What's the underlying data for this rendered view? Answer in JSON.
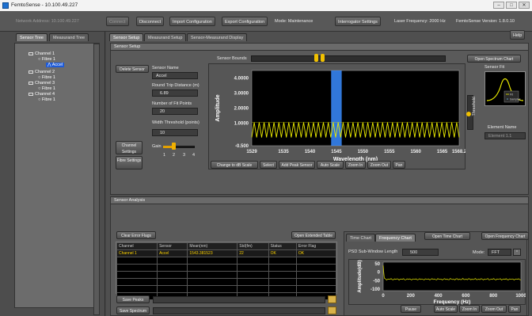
{
  "window": {
    "title": "FemtoSense - 10.100.49.227"
  },
  "toolbar": {
    "network_address": "Network Address: 10.100.49.227",
    "connect": "Connect",
    "disconnect": "Disconnect",
    "import_config": "Import Configuration",
    "export_config": "Export Configuration",
    "mode": "Mode: Maintenance",
    "interrogator_settings": "Interrogator Settings",
    "laser_frequency": "Laser Frequency: 2000 Hz",
    "version": "FemtoSense Version: 1.8.0.10",
    "help": "Help"
  },
  "left_tabs": [
    "Sensor Tree",
    "Measurand Tree"
  ],
  "tree": [
    {
      "label": "Channel 1",
      "level": 0
    },
    {
      "label": "Fibre 1",
      "level": 1
    },
    {
      "label": "Accel",
      "level": 2,
      "selected": true
    },
    {
      "label": "Channel 2",
      "level": 0
    },
    {
      "label": "Fibre 1",
      "level": 1
    },
    {
      "label": "Channel 3",
      "level": 0
    },
    {
      "label": "Fibre 1",
      "level": 1
    },
    {
      "label": "Channel 4",
      "level": 0
    },
    {
      "label": "Fibre 1",
      "level": 1
    }
  ],
  "main_tabs": [
    "Sensor Setup",
    "Measurand Setup",
    "Sensor-Measurand Display"
  ],
  "sensor_setup": {
    "section_title": "Sensor Setup",
    "delete_sensor": "Delete Sensor",
    "sensor_name_label": "Sensor Name",
    "sensor_name": "Accel",
    "rtd_label": "Round Trip Distance (m)",
    "rtd_value": "6.89",
    "fit_points_label": "Number of Fit Points",
    "fit_points_value": "20",
    "width_threshold_label": "Width Threshold (points)",
    "width_threshold_value": "10",
    "gain_label": "Gain",
    "gain_ticks": [
      "1",
      "2",
      "3",
      "4"
    ],
    "gain_value": 2,
    "channel_settings": "Channel Settings",
    "fibre_settings": "Fibre Settings",
    "sensor_bounds": "Sensor Bounds",
    "open_spectrum_chart": "Open Spectrum Chart",
    "sensor_fit": "Sensor Fit",
    "threshold": "Threshold",
    "element_name_label": "Element Name",
    "element_name": "Element 1.1",
    "fit_legend": [
      "Fit",
      "Samples"
    ]
  },
  "spectrum_chart": {
    "type": "line",
    "xlabel": "Wavelength (nm)",
    "ylabel": "Amplitude",
    "x_ticks": [
      "1529",
      "1535",
      "1540",
      "1545",
      "1550",
      "1555",
      "1560",
      "1565",
      "1568.2"
    ],
    "y_ticks": [
      "4.0000",
      "3.0000",
      "2.0000",
      "1.0000",
      "-0.500"
    ],
    "xlim": [
      1529,
      1568.2
    ],
    "ylim": [
      -0.5,
      4.5
    ],
    "sensor_window": [
      1544,
      1546
    ],
    "buttons": [
      "Change to dB Scale",
      "Select",
      "Add Peak Sensor",
      "Auto Scale",
      "Zoom In",
      "Zoom Out",
      "Pan"
    ]
  },
  "analysis": {
    "section_title": "Sensor Analysis",
    "clear_error_flags": "Clear Error Flags",
    "open_extended_table": "Open Extended Table",
    "columns": [
      "Channel",
      "Sensor",
      "Mean(nm)",
      "Std(fm)",
      "Status",
      "Error Flag"
    ],
    "rows": [
      [
        "Channel 1",
        "Accel",
        "1543.381523",
        "22",
        "OK",
        "OK"
      ]
    ],
    "save_peaks": "Save Peaks",
    "save_spectrum": "Save Spectrum"
  },
  "freq_panel": {
    "tabs": [
      "Time Chart",
      "Frequency Chart"
    ],
    "open_time_chart": "Open Time Chart",
    "open_frequency_chart": "Open Frequency Chart",
    "psd_label": "PSD Sub-Window Length",
    "psd_value": "500",
    "mode_label": "Mode:",
    "mode_value": "FFT",
    "xlabel": "Frequency (Hz)",
    "ylabel": "Amplitude(dB)",
    "x_ticks": [
      "0",
      "200",
      "400",
      "600",
      "800",
      "1000"
    ],
    "y_ticks": [
      "50",
      "0",
      "-50",
      "-100"
    ],
    "buttons": [
      "Pause",
      "Auto Scale",
      "Zoom In",
      "Zoom Out",
      "Pan"
    ]
  },
  "colors": {
    "trace": "#e8e800",
    "window": "#3a8cff",
    "text_value": "#ffd400"
  }
}
